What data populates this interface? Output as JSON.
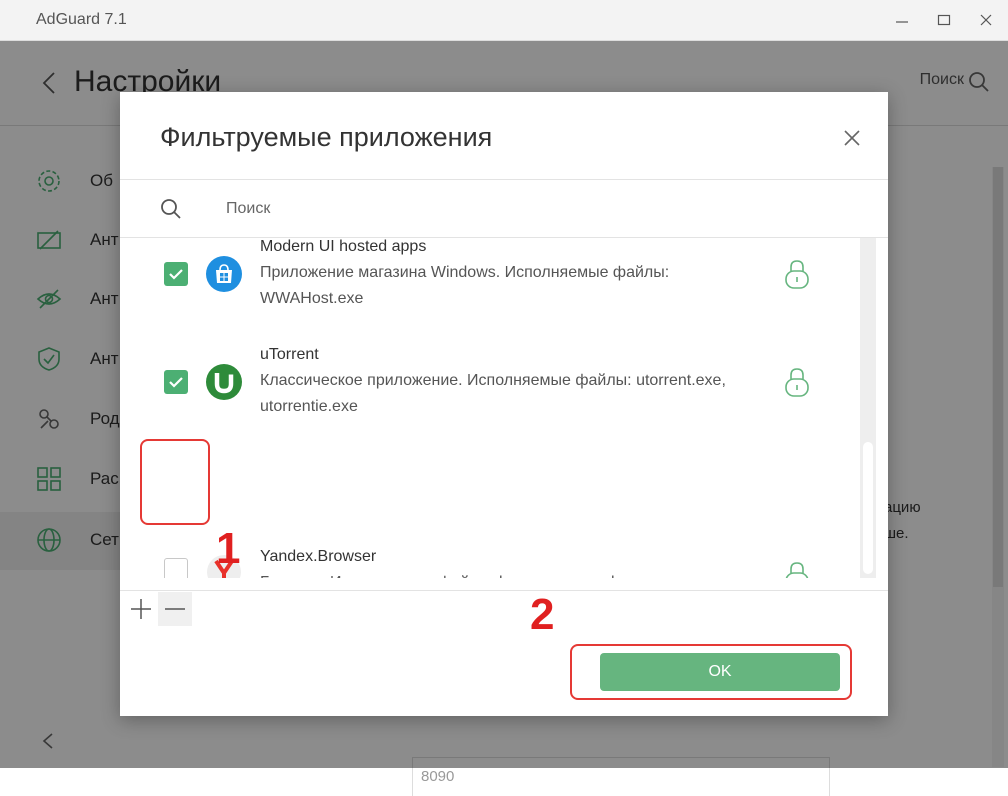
{
  "window": {
    "title": "AdGuard 7.1"
  },
  "header": {
    "title": "Настройки",
    "search_label": "Поиск"
  },
  "sidebar": {
    "items": [
      {
        "label": "Об",
        "icon": "gear-icon"
      },
      {
        "label": "Ант",
        "icon": "ad-block-icon"
      },
      {
        "label": "Ант",
        "icon": "eye-off-icon"
      },
      {
        "label": "Ант",
        "icon": "shield-icon"
      },
      {
        "label": "Род",
        "icon": "parental-icon"
      },
      {
        "label": "Рас",
        "icon": "extensions-icon"
      },
      {
        "label": "Сет",
        "icon": "globe-icon"
      }
    ]
  },
  "background": {
    "text_line1": "ацию",
    "text_line2": "ше.",
    "port_value": "8090"
  },
  "modal": {
    "title": "Фильтруемые приложения",
    "search_placeholder": "Поиск",
    "apps": [
      {
        "name": "Modern UI hosted apps",
        "desc_line1": "Приложение магазина Windows. Исполняемые файлы:",
        "desc_line2": "WWAHost.exe",
        "checked": true,
        "icon": "windows-store-icon"
      },
      {
        "name": "uTorrent",
        "desc_line1": "Классическое приложение. Исполняемые файлы: utorrent.exe,",
        "desc_line2": "utorrentie.exe",
        "checked": true,
        "icon": "utorrent-icon"
      },
      {
        "name": "Yandex.Browser",
        "desc_line1": "Браузер. Исполняемые файлы: browser.exe, yabrowser.exe",
        "desc_line2": "",
        "checked": false,
        "icon": "yandex-browser-icon"
      }
    ],
    "ok_label": "OK"
  },
  "annotations": {
    "marker1": "1",
    "marker2": "2"
  },
  "colors": {
    "accent": "#66b57f",
    "checkbox": "#4caf73",
    "annotation": "#e02020"
  }
}
